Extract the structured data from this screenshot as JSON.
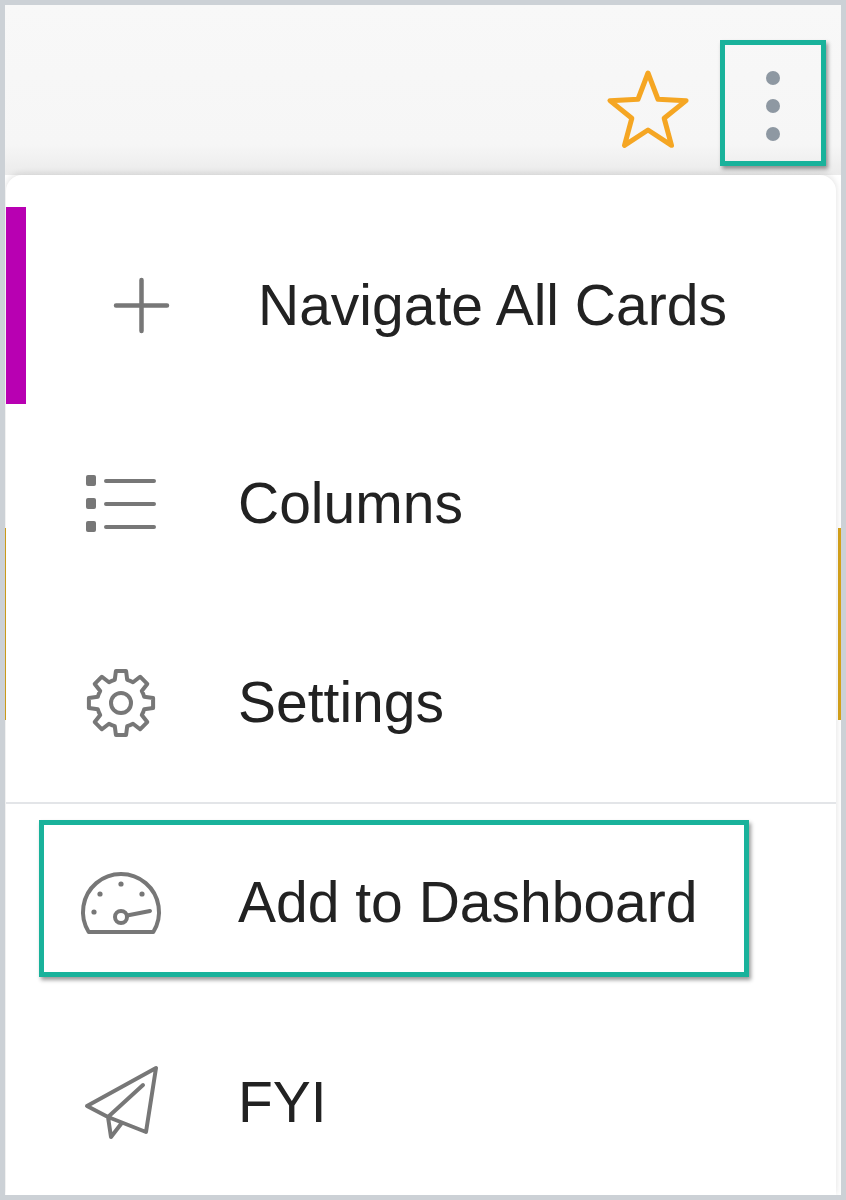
{
  "header": {
    "favorite": {
      "starred": false
    },
    "more_button": {
      "highlighted": true
    }
  },
  "menu": {
    "sections": [
      {
        "items": [
          {
            "kind": "add",
            "label": "Navigate All Cards",
            "selected": true,
            "highlighted": false
          },
          {
            "kind": "columns",
            "label": "Columns",
            "selected": false,
            "highlighted": false
          },
          {
            "kind": "settings",
            "label": "Settings",
            "selected": false,
            "highlighted": false
          }
        ]
      },
      {
        "items": [
          {
            "kind": "dashboard",
            "label": "Add to Dashboard",
            "selected": false,
            "highlighted": true
          },
          {
            "kind": "share",
            "label": "FYI",
            "selected": false,
            "highlighted": false
          }
        ]
      }
    ]
  }
}
